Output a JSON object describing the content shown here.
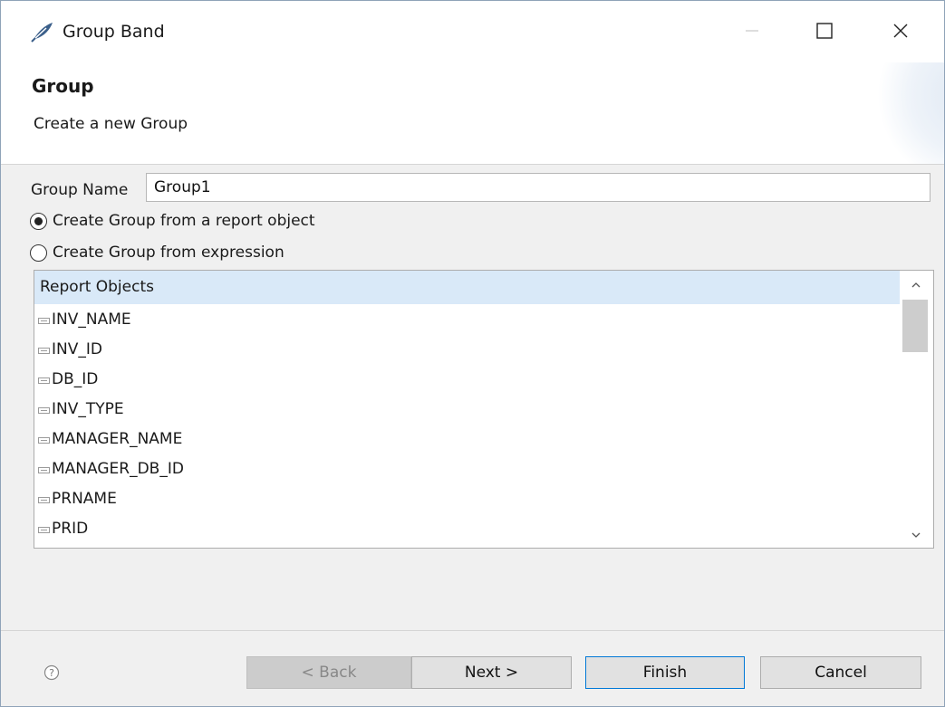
{
  "window": {
    "title": "Group Band",
    "icon": "feather-icon",
    "controls": {
      "minimize": "minimize-icon",
      "maximize": "maximize-icon",
      "close": "close-icon"
    }
  },
  "banner": {
    "title": "Group",
    "subtitle": "Create a new Group"
  },
  "form": {
    "group_name_label": "Group Name",
    "group_name_value": "Group1",
    "radio_report_object": {
      "label": "Create Group from a report object",
      "selected": true
    },
    "radio_expression": {
      "label": "Create Group from expression",
      "selected": false
    }
  },
  "report_objects": {
    "header": "Report Objects",
    "items": [
      "INV_NAME",
      "INV_ID",
      "DB_ID",
      "INV_TYPE",
      "MANAGER_NAME",
      "MANAGER_DB_ID",
      "PRNAME",
      "PRID"
    ]
  },
  "buttons": {
    "back": "< Back",
    "next": "Next >",
    "finish": "Finish",
    "cancel": "Cancel"
  },
  "colors": {
    "list_header_bg": "#d9e9f8",
    "default_button_border": "#0078d7",
    "dialog_bg": "#f0f0f0"
  }
}
